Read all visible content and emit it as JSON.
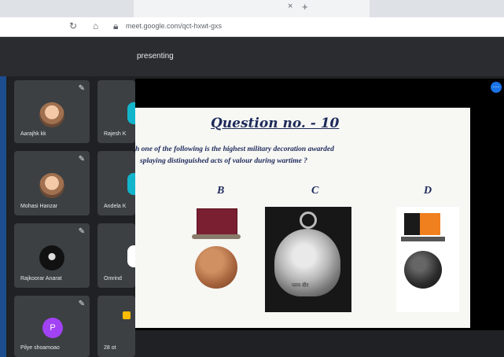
{
  "browser": {
    "tab_close": "×",
    "new_tab": "+",
    "url": "meet.google.com/qct-hxwt-gxs"
  },
  "meet": {
    "presenting_label": "presenting"
  },
  "participants": [
    {
      "name": "Aarajhk kk",
      "avatar": "photo"
    },
    {
      "name": "Rajesh K",
      "avatar": "cyan"
    },
    {
      "name": "Mohasi Hanzar",
      "avatar": "photo"
    },
    {
      "name": "Andela K",
      "avatar": "cyan"
    },
    {
      "name": "Rajkoorar Anarat",
      "avatar": "dark"
    },
    {
      "name": "Omrind",
      "avatar": "cyan"
    },
    {
      "name": "Pilye shoamoao",
      "avatar": "letter",
      "initial": "P"
    },
    {
      "name": "28 ot",
      "avatar": "yellow"
    }
  ],
  "slide": {
    "title": "Question no. - 10",
    "question_line1": "h one of the following is the highest military decoration awarded",
    "question_line2": "splaying distinguished acts of valour during wartime ?",
    "options": [
      "B",
      "C",
      "D"
    ],
    "medal_c_inscription": "परम वीर"
  },
  "icons": {
    "pin": "pin-icon",
    "more": "more-options-icon"
  }
}
